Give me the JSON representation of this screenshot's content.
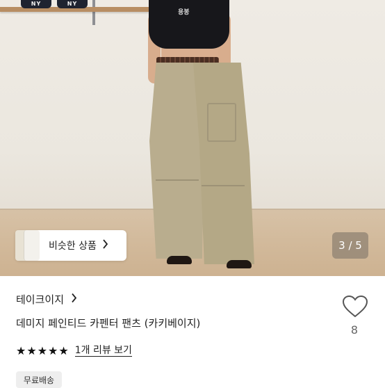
{
  "gallery": {
    "similar_products_label": "비슷한 상품",
    "counter": "3 / 5",
    "current_index": 3,
    "total_images": 5
  },
  "shelf_caps": [
    "NY",
    "NY"
  ],
  "shirt_logo": "용봉",
  "product": {
    "shop_name": "테이크이지",
    "title": "데미지 페인티드 카펜터 팬츠 (카키베이지)",
    "rating": 5,
    "review_link": "1개 리뷰 보기",
    "badge": "무료배송",
    "like_count": "8"
  },
  "icons": {
    "chevron": "chevron-right-icon",
    "like": "heart-outline-icon",
    "star": "star-filled-icon"
  },
  "colors": {
    "text": "#222222",
    "badge_bg": "#eeeeee",
    "counter_bg": "#8c8070"
  }
}
